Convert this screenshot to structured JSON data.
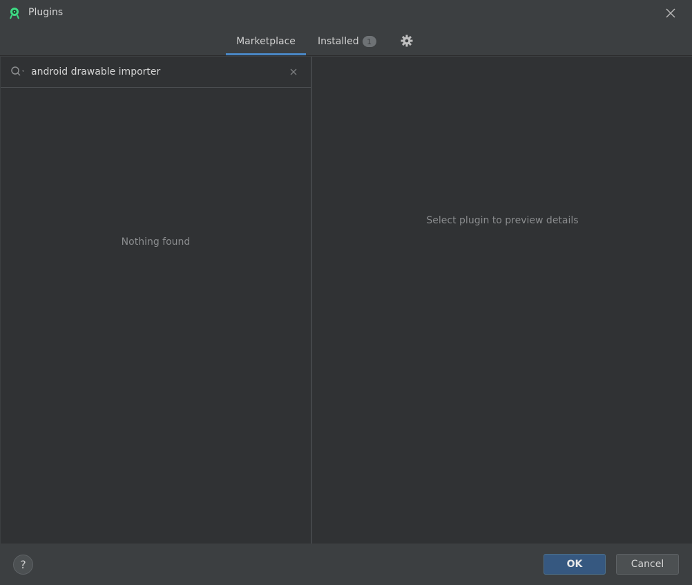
{
  "window": {
    "title": "Plugins",
    "app_icon": "android-studio-icon",
    "close_icon": "close-icon"
  },
  "tabs": [
    {
      "label": "Marketplace",
      "active": true
    },
    {
      "label": "Installed",
      "badge": "1",
      "active": false
    }
  ],
  "settings_icon": "gear-icon",
  "search": {
    "value": "android drawable importer",
    "placeholder": ""
  },
  "results": {
    "empty_text": "Nothing found"
  },
  "details": {
    "empty_text": "Select plugin to preview details"
  },
  "footer": {
    "help_label": "?",
    "ok_label": "OK",
    "cancel_label": "Cancel"
  },
  "colors": {
    "accent": "#4a88c7",
    "ok_button": "#365880",
    "background": "#3c3f41",
    "panel": "#303234"
  }
}
